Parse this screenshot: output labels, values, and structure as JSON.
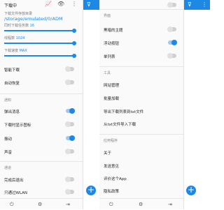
{
  "left": {
    "header_title": "下载中",
    "chart_icon": "chart-icon",
    "eye_icon": "eye-icon",
    "more_icon": "more-icon",
    "download_path_label": "下载文件存放目录",
    "download_path": "/storage/emulated/0/ADM",
    "tasks_label": "同时下载任务数",
    "tasks_value": "16",
    "tasks_fraction": 1.0,
    "threads_label": "线程数",
    "threads_value": "1024",
    "threads_fraction": 1.0,
    "speed_label": "下载速度",
    "speed_value": "MAX",
    "speed_fraction": 1.0,
    "smart_download": "智能下载",
    "smart_download_on": false,
    "auto_resume": "自动恢复",
    "auto_resume_on": false,
    "section_notify": "通知",
    "popup_msg": "弹出消息",
    "popup_msg_on": true,
    "download_icon": "下载时显示图标",
    "download_icon_on": false,
    "vibrate": "振动",
    "vibrate_on": true,
    "sound": "声音",
    "sound_on": false,
    "section_other": "通道",
    "exit_on_finish": "完成后退出",
    "exit_on_finish_on": false,
    "wifi_only": "只通过WLAN",
    "wifi_only_on": false,
    "bottom_icons": [
      "power-icon",
      "settings-icon",
      "exit-icon"
    ]
  },
  "right": {
    "section_ui": "界面",
    "dark_theme": "黑暗的主题",
    "dark_theme_on": false,
    "floating_button": "浮动按钮",
    "floating_button_on": true,
    "single_list": "单列表",
    "single_list_on": false,
    "section_tools": "工具",
    "site_manager": "网站管理",
    "batch_download": "批量加载",
    "export_list": "导出下载列表到txt文件",
    "import_list": "从txt文件导入下载",
    "section_app": "应用程序",
    "about": "关于",
    "feedback": "发送意见",
    "rate_app": "评价这个App",
    "privacy": "隐私政策",
    "bottom_icons": [
      "power-icon",
      "settings-icon",
      "exit-icon"
    ]
  },
  "background": {
    "filter_icon": "filter-icon",
    "more_icon": "more-icon",
    "fab_symbol": "+"
  },
  "colors": {
    "accent": "#1e88e5",
    "toggle_on_track": "#9cc8f3",
    "toggle_off_track": "#cfcfcf"
  }
}
